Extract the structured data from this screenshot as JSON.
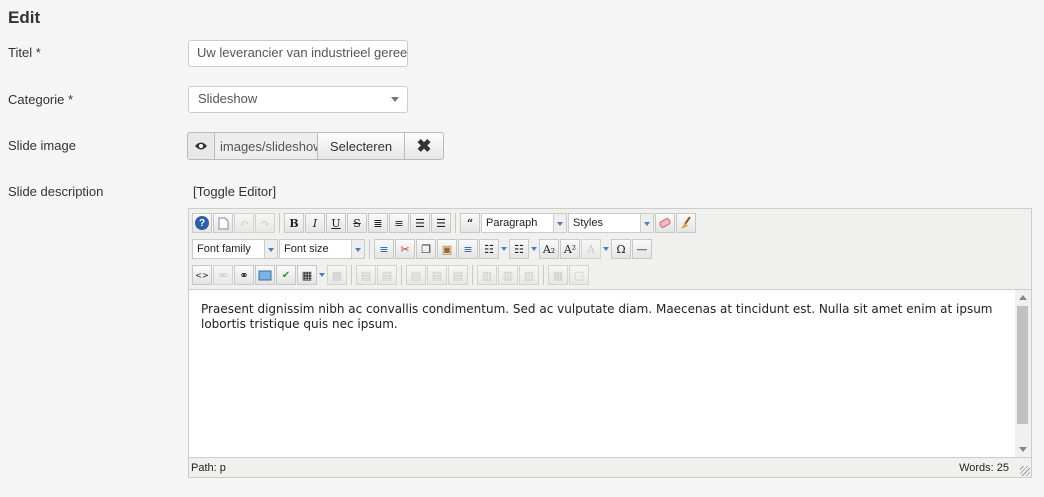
{
  "page": {
    "heading": "Edit"
  },
  "form": {
    "title_label": "Titel *",
    "title_value": "Uw leverancier van industrieel gereedschap",
    "category_label": "Categorie *",
    "category_value": "Slideshow",
    "image_label": "Slide image",
    "image_path": "images/slideshow/",
    "image_select": "Selecteren",
    "image_clear": "✖",
    "description_label": "Slide description"
  },
  "editor": {
    "toggle": "[Toggle Editor]",
    "toolbar": {
      "format_select": "Paragraph",
      "styles_select": "Styles",
      "font_family": "Font family",
      "font_size": "Font size"
    },
    "content": "Praesent dignissim nibh ac convallis condimentum. Sed ac vulputate diam. Maecenas at tincidunt est. Nulla sit amet enim at ipsum lobortis tristique quis nec ipsum.",
    "status_path": "Path:  p",
    "status_words": "Words: 25"
  },
  "icons": [
    "help-icon",
    "new-document-icon",
    "undo-icon",
    "redo-icon",
    "bold-icon",
    "italic-icon",
    "underline-icon",
    "strikethrough-icon",
    "align-justify-icon",
    "align-center-icon",
    "align-left-icon",
    "align-right-icon",
    "blockquote-icon",
    "remove-format-icon",
    "cleanup-icon",
    "indent-icon",
    "cut-icon",
    "copy-icon",
    "paste-icon",
    "outdent-icon",
    "ordered-list-icon",
    "unordered-list-icon",
    "subscript-icon",
    "superscript-icon",
    "text-color-icon",
    "special-char-icon",
    "horizontal-rule-icon",
    "code-icon",
    "unlink-icon",
    "link-icon",
    "image-icon",
    "spellcheck-icon",
    "table-icon",
    "eye-icon",
    "close-icon"
  ]
}
